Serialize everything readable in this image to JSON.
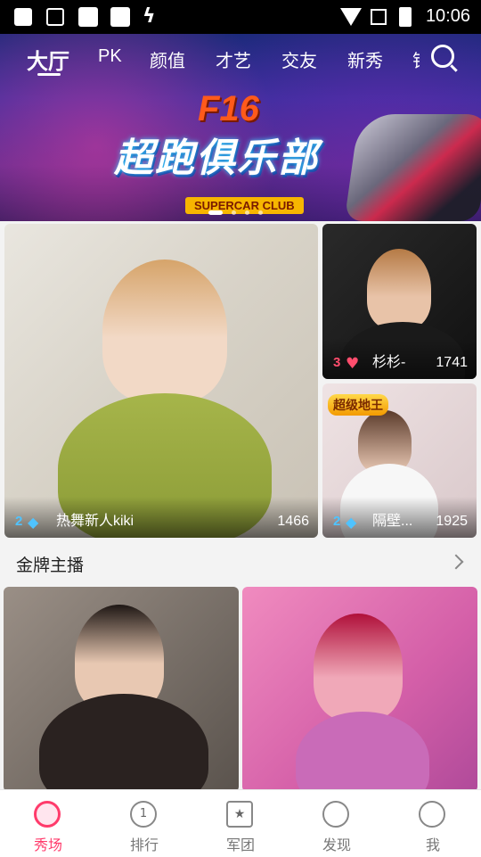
{
  "status_bar": {
    "time": "10:06"
  },
  "header": {
    "tabs": [
      "大厅",
      "PK",
      "颜值",
      "才艺",
      "交友",
      "新秀"
    ],
    "active_tab": "大厅"
  },
  "banner": {
    "code": "F16",
    "title": "超跑俱乐部",
    "subtitle": "SUPERCAR CLUB"
  },
  "featured": [
    {
      "level": "2",
      "name": "热舞新人kiki",
      "viewers": "1466"
    },
    {
      "level": "3",
      "name": "杉杉-",
      "viewers": "1741"
    },
    {
      "level": "2",
      "name": "隔壁...",
      "viewers": "1925",
      "tag": "超级地王"
    }
  ],
  "section": {
    "title": "金牌主播"
  },
  "bottom_nav": [
    {
      "label": "秀场",
      "active": true
    },
    {
      "label": "排行",
      "active": false
    },
    {
      "label": "军团",
      "active": false
    },
    {
      "label": "发现",
      "active": false
    },
    {
      "label": "我",
      "active": false
    }
  ],
  "colors": {
    "accent": "#ff3b6b",
    "diamond": "#4fc3ff",
    "heart": "#ff4d6d"
  }
}
